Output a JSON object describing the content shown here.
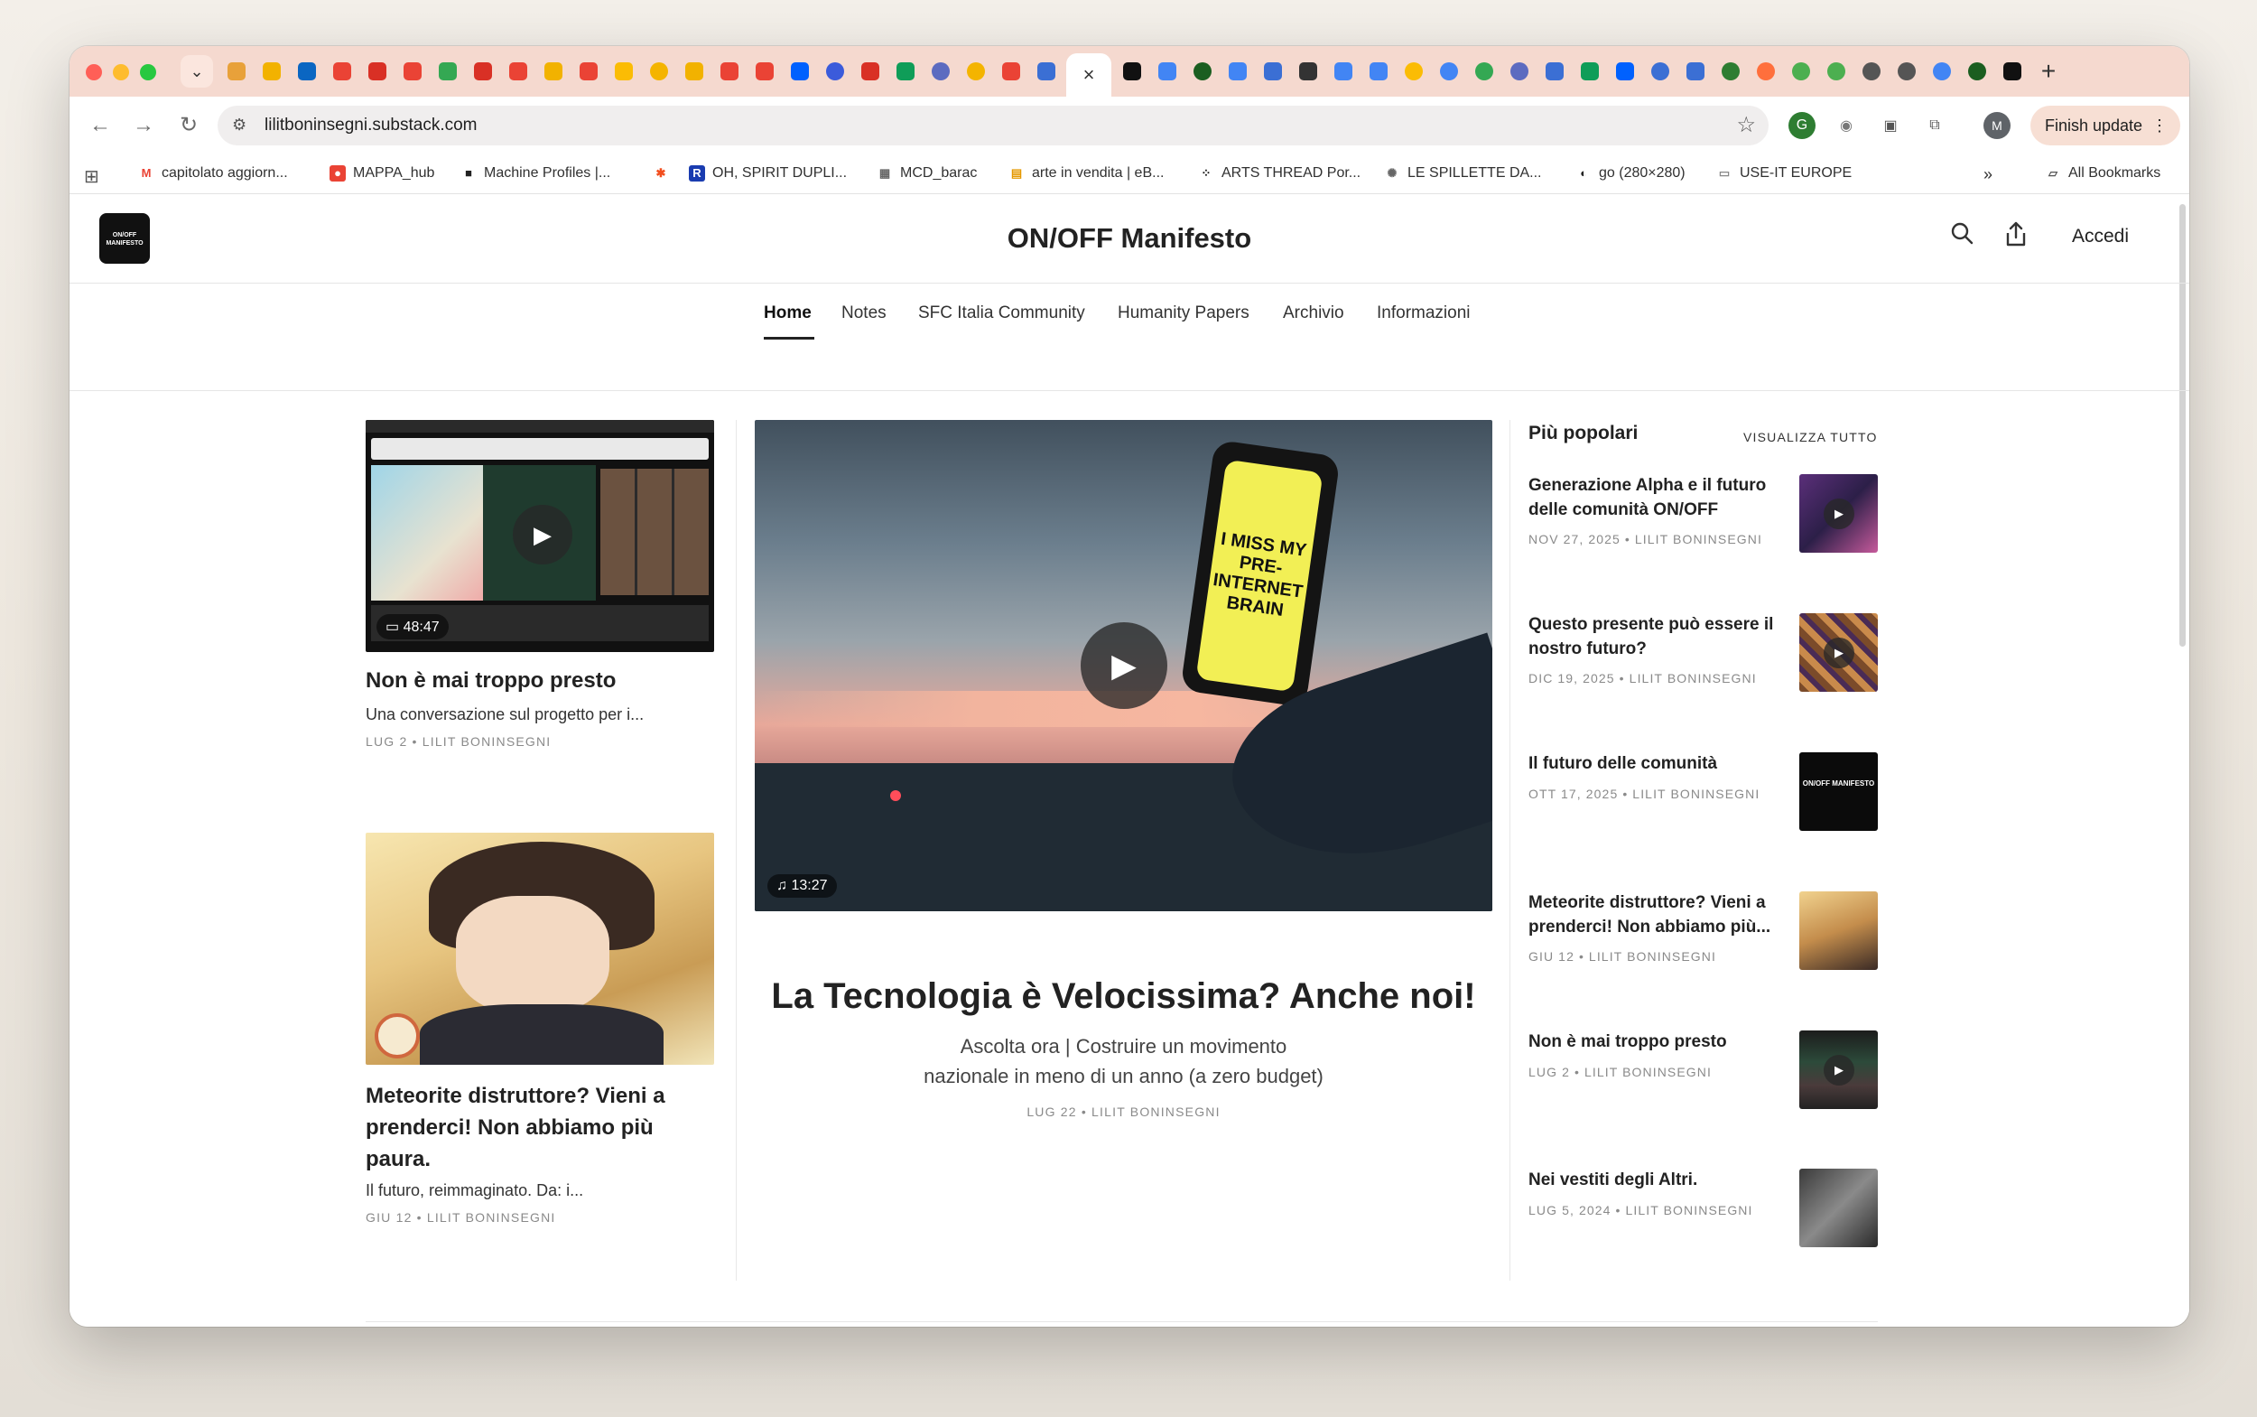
{
  "browser": {
    "url": "lilitboninsegni.substack.com",
    "finish_update": "Finish update",
    "new_tab": "+",
    "close_tab": "×",
    "tab_menu": "⌄",
    "profile_initial": "M"
  },
  "bookmarks": {
    "items": [
      "capitolato aggiorn...",
      "MAPPA_hub",
      "Machine Profiles |...",
      "OH, SPIRIT DUPLI...",
      "MCD_barac",
      "arte in vendita | eB...",
      "ARTS THREAD Por...",
      "LE SPILLETTE DA...",
      "go (280×280)",
      "USE-IT EUROPE"
    ],
    "overflow": "»",
    "all": "All Bookmarks"
  },
  "site": {
    "title": "ON/OFF Manifesto",
    "logo_text": "ON/OFF MANIFESTO",
    "signin": "Accedi",
    "nav": [
      "Home",
      "Notes",
      "SFC Italia Community",
      "Humanity Papers",
      "Archivio",
      "Informazioni"
    ]
  },
  "left_posts": [
    {
      "title": "Non è mai troppo presto",
      "subtitle": "Una conversazione sul progetto per i...",
      "meta": "LUG 2 • LILIT BONINSEGNI",
      "duration": "48:47"
    },
    {
      "title": "Meteorite distruttore? Vieni a prenderci! Non abbiamo più paura.",
      "subtitle": "Il futuro, reimmaginato. Da: i...",
      "meta": "GIU 12 • LILIT BONINSEGNI"
    }
  ],
  "featured": {
    "title": "La Tecnologia è Velocissima? Anche noi!",
    "subtitle_line1": "Ascolta ora | Costruire un movimento",
    "subtitle_line2": "nazionale in meno di un anno (a zero budget)",
    "meta": "LUG 22 • LILIT BONINSEGNI",
    "duration": "13:27",
    "phone_text": "I MISS MY PRE-INTERNET BRAIN"
  },
  "popular": {
    "heading": "Più popolari",
    "view_all": "VISUALIZZA TUTTO",
    "items": [
      {
        "title": "Generazione Alpha e il futuro delle comunità ON/OFF",
        "meta": "NOV 27, 2025 • LILIT BONINSEGNI"
      },
      {
        "title": "Questo presente può essere il nostro futuro?",
        "meta": "DIC 19, 2025 • LILIT BONINSEGNI"
      },
      {
        "title": "Il futuro delle comunità",
        "meta": "OTT 17, 2025 • LILIT BONINSEGNI"
      },
      {
        "title": "Meteorite distruttore? Vieni a prenderci! Non abbiamo più...",
        "meta": "GIU 12 • LILIT BONINSEGNI"
      },
      {
        "title": "Non è mai troppo presto",
        "meta": "LUG 2 • LILIT BONINSEGNI"
      },
      {
        "title": "Nei vestiti degli Altri.",
        "meta": "LUG 5, 2024 • LILIT BONINSEGNI"
      }
    ]
  },
  "colors": {
    "tab_strip": "#f5d9cf",
    "accent_dark": "#222222",
    "meta_gray": "#8a8a8a"
  },
  "icons": [
    "search-icon",
    "share-icon",
    "star-icon",
    "reload-icon",
    "back-icon",
    "forward-icon",
    "play-icon",
    "video-icon",
    "headphones-icon",
    "folder-icon",
    "apps-grid-icon"
  ]
}
